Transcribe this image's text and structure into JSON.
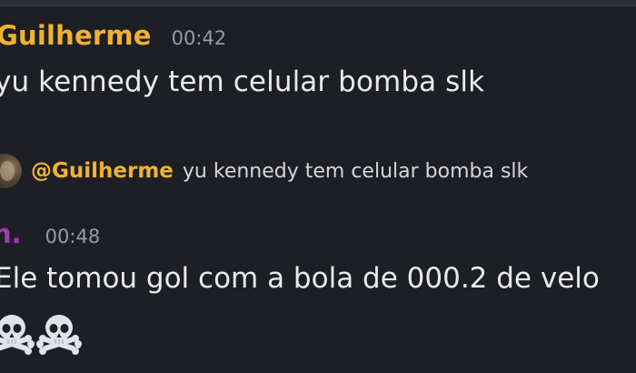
{
  "messages": [
    {
      "author": "Guilherme",
      "timestamp": "00:42",
      "text": "yu kennedy tem celular bomba slk"
    },
    {
      "reply_to": {
        "mention": "@Guilherme",
        "preview": "yu kennedy tem celular bomba slk"
      },
      "author": "h.",
      "timestamp": "00:48",
      "text": "Ele tomou gol com a bola de 000.2 de velo",
      "emojis": [
        "skull-and-crossbones",
        "skull-and-crossbones"
      ]
    }
  ],
  "colors": {
    "background": "#1e1f25",
    "author_1": "#f0b232",
    "author_2": "#a03ab5",
    "timestamp": "#9a9ca3",
    "message_text": "#e9eaec"
  }
}
